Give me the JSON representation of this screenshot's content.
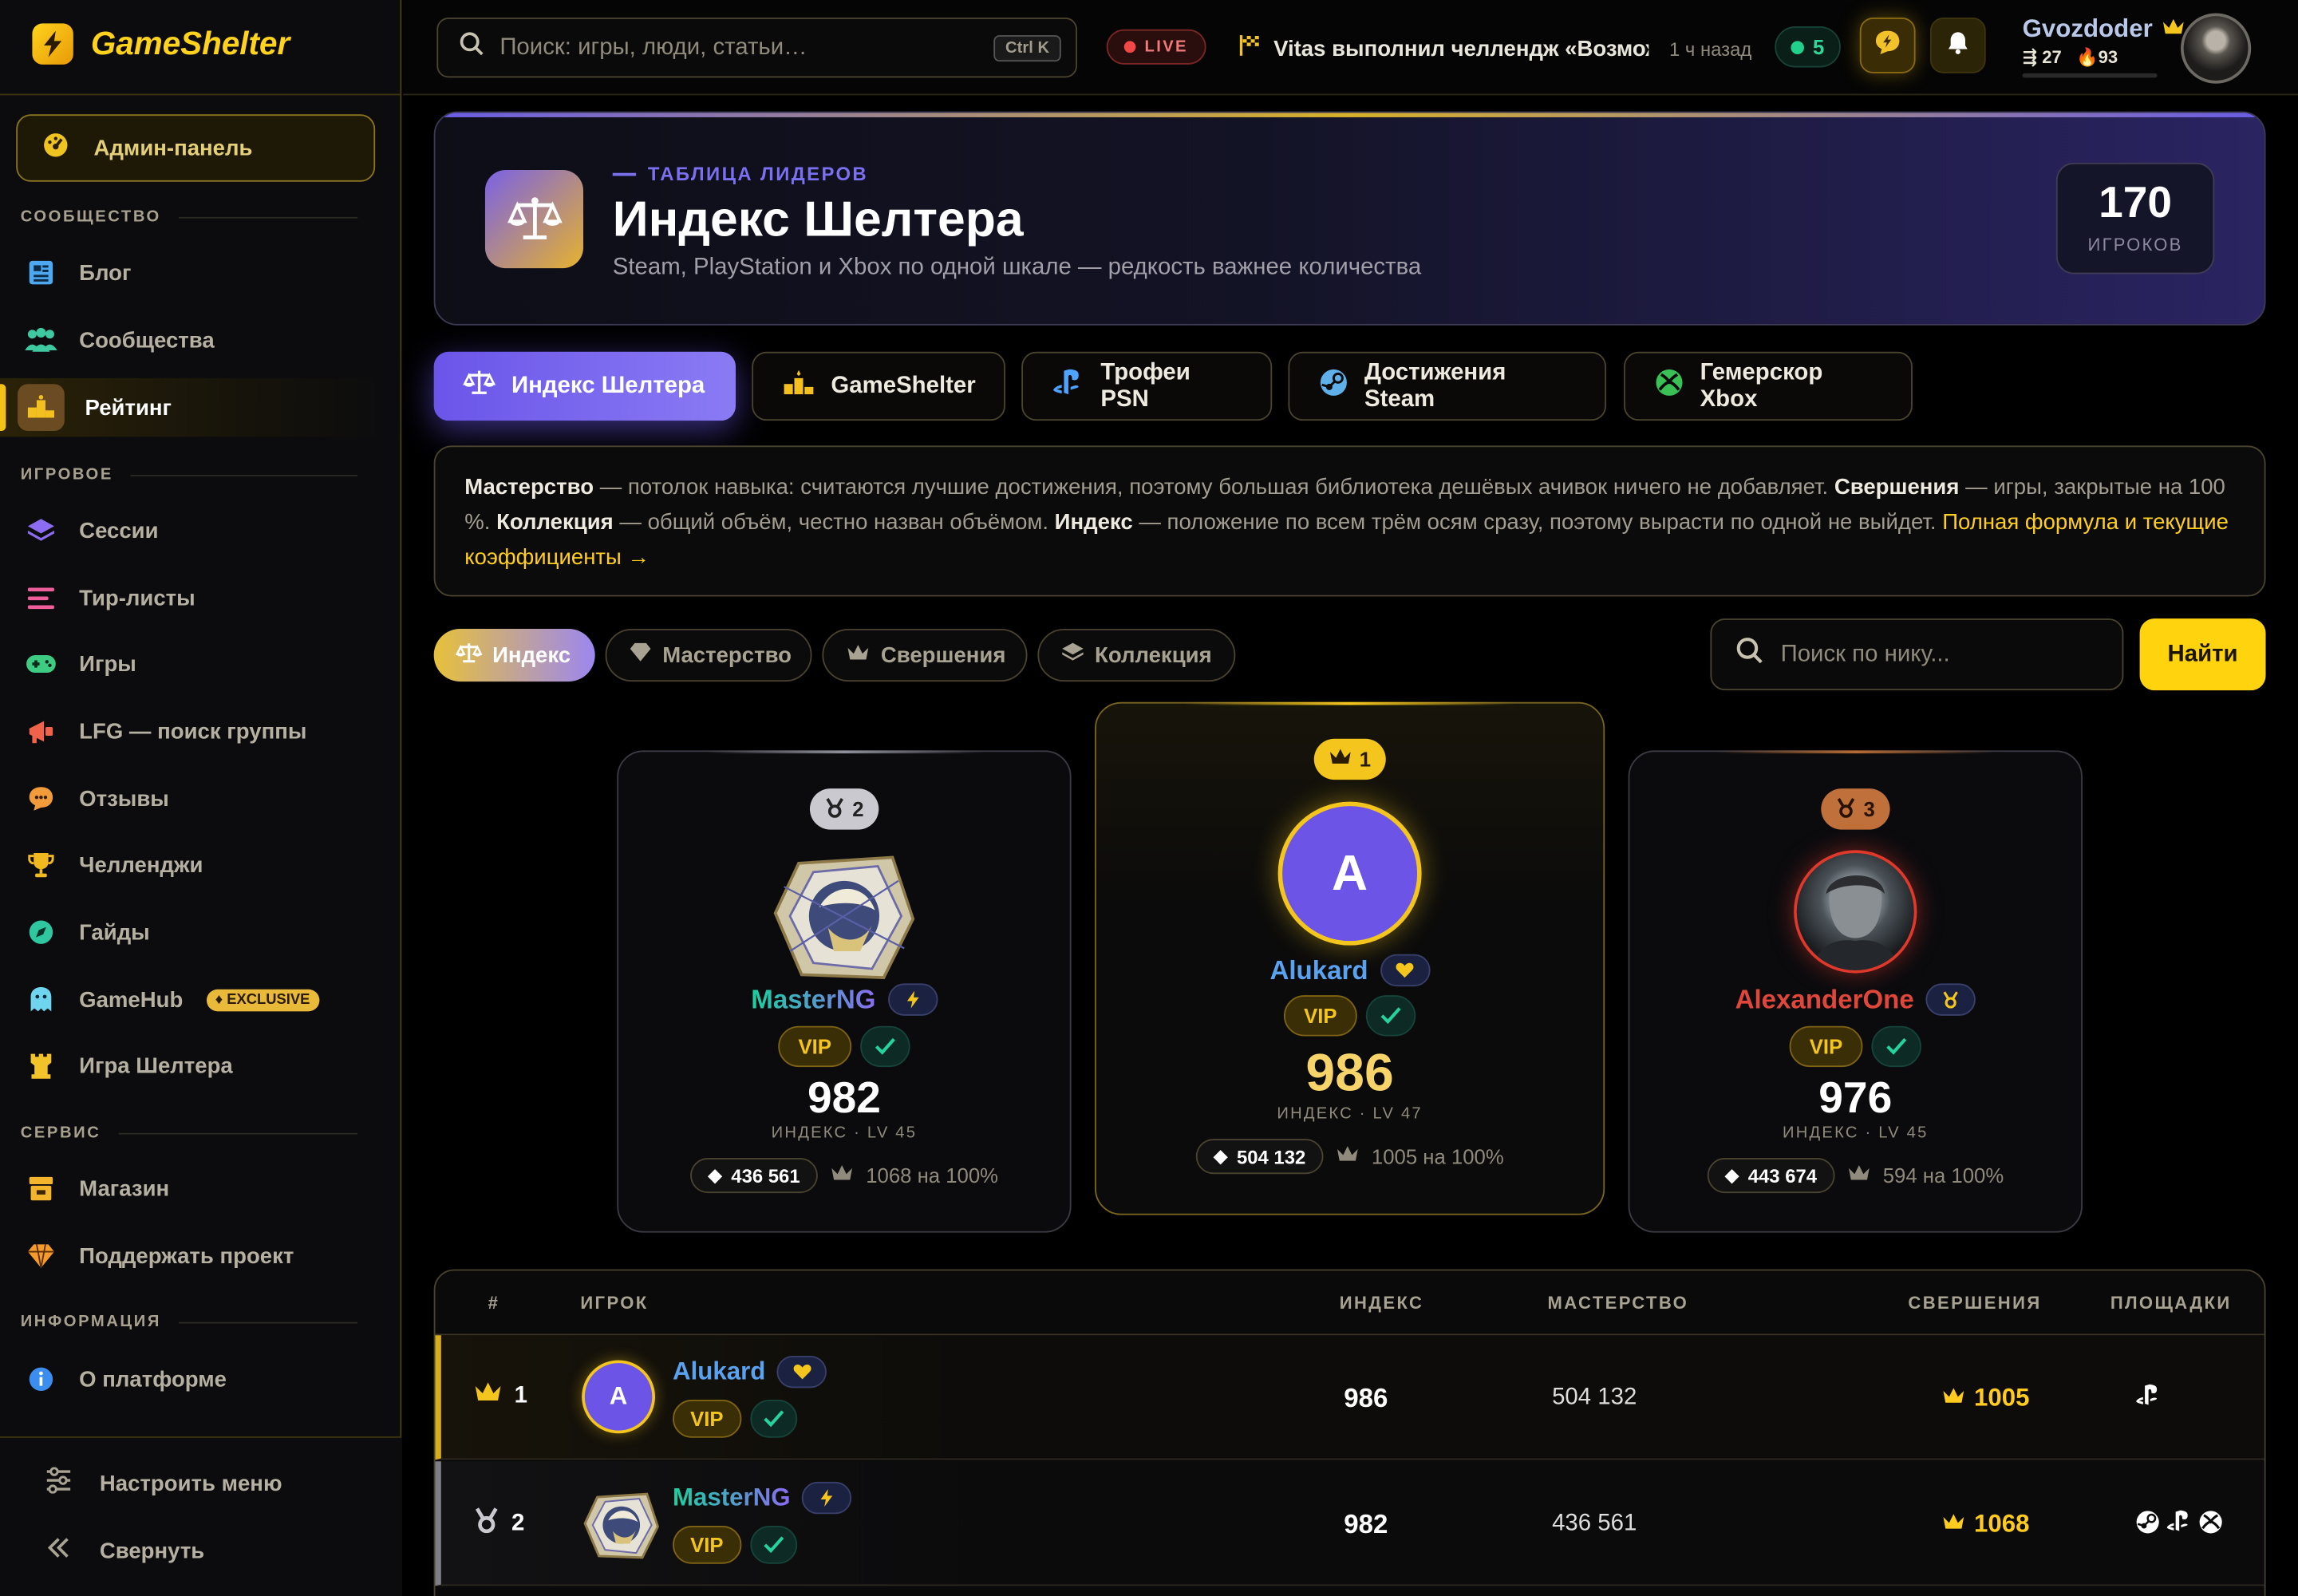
{
  "app": {
    "name": "GameShelter"
  },
  "sidebar": {
    "admin": "Админ-панель",
    "sections": {
      "community": "СООБЩЕСТВО",
      "gaming": "ИГРОВОЕ",
      "service": "СЕРВИС",
      "info": "ИНФОРМАЦИЯ"
    },
    "items": [
      {
        "label": "Блог",
        "icon": "newspaper-icon"
      },
      {
        "label": "Сообщества",
        "icon": "people-icon"
      },
      {
        "label": "Рейтинг",
        "icon": "podium-icon",
        "active": true
      },
      {
        "label": "Сессии",
        "icon": "layers-icon"
      },
      {
        "label": "Тир-листы",
        "icon": "list-icon"
      },
      {
        "label": "Игры",
        "icon": "gamepad-icon"
      },
      {
        "label": "LFG — поиск группы",
        "icon": "megaphone-icon"
      },
      {
        "label": "Отзывы",
        "icon": "chat-icon"
      },
      {
        "label": "Челленджи",
        "icon": "trophy-icon"
      },
      {
        "label": "Гайды",
        "icon": "compass-icon"
      },
      {
        "label": "GameHub",
        "icon": "ghost-icon",
        "badge": "EXCLUSIVE"
      },
      {
        "label": "Игра Шелтера",
        "icon": "tower-icon"
      },
      {
        "label": "Магазин",
        "icon": "shop-icon"
      },
      {
        "label": "Поддержать проект",
        "icon": "diamond-icon"
      },
      {
        "label": "О платформе",
        "icon": "info-icon"
      }
    ],
    "customize": "Настроить меню",
    "collapse": "Свернуть"
  },
  "topbar": {
    "search_placeholder": "Поиск: игры, люди, статьи…",
    "search_shortcut": "Ctrl K",
    "live": "LIVE",
    "ticker_text": "Vitas выполнил челлендж «Возможности»",
    "ticker_time": "1 ч назад",
    "online": "5",
    "user": {
      "name": "Gvozdoder",
      "followers": "27",
      "streak": "93"
    }
  },
  "hero": {
    "kicker": "ТАБЛИЦА ЛИДЕРОВ",
    "title": "Индекс Шелтера",
    "subtitle": "Steam, PlayStation и Xbox по одной шкале — редкость важнее количества",
    "count": "170",
    "count_label": "ИГРОКОВ"
  },
  "tabs": [
    "Индекс Шелтера",
    "GameShelter",
    "Трофеи PSN",
    "Достижения Steam",
    "Гемерскор Xbox"
  ],
  "info": {
    "t1": "Мастерство",
    "t2": " — потолок навыка: считаются лучшие достижения, поэтому большая библиотека дешёвых ачивок ничего не добавляет. ",
    "t3": "Свершения",
    "t4": " — игры, закрытые на 100 %. ",
    "t5": "Коллекция",
    "t6": " — общий объём, честно назван объёмом. ",
    "t7": "Индекс",
    "t8": " — положение по всем трём осям сразу, поэтому вырасти по одной не выйдет. ",
    "link": "Полная формула и текущие коэффициенты →"
  },
  "filters": [
    "Индекс",
    "Мастерство",
    "Свершения",
    "Коллекция"
  ],
  "nick_search": {
    "placeholder": "Поиск по нику...",
    "button": "Найти"
  },
  "podium": [
    {
      "place": "2",
      "name": "MasterNG",
      "vip": "VIP",
      "score": "982",
      "label": "ИНДЕКС · LV 45",
      "mastery": "436 561",
      "completed": "1068 на 100%"
    },
    {
      "place": "1",
      "name": "Alukard",
      "initial": "A",
      "vip": "VIP",
      "score": "986",
      "label": "ИНДЕКС · LV 47",
      "mastery": "504 132",
      "completed": "1005 на 100%"
    },
    {
      "place": "3",
      "name": "AlexanderOne",
      "vip": "VIP",
      "score": "976",
      "label": "ИНДЕКС · LV 45",
      "mastery": "443 674",
      "completed": "594 на 100%"
    }
  ],
  "table": {
    "headers": {
      "rank": "#",
      "player": "ИГРОК",
      "index": "ИНДЕКС",
      "mastery": "МАСТЕРСТВО",
      "completed": "СВЕРШЕНИЯ",
      "platforms": "ПЛОЩАДКИ"
    },
    "rows": [
      {
        "rank": "1",
        "name": "Alukard",
        "initial": "A",
        "vip": "VIP",
        "index": "986",
        "mastery": "504 132",
        "completed": "1005",
        "platforms": [
          "playstation-icon"
        ]
      },
      {
        "rank": "2",
        "name": "MasterNG",
        "vip": "VIP",
        "index": "982",
        "mastery": "436 561",
        "completed": "1068",
        "platforms": [
          "steam-icon",
          "playstation-icon",
          "xbox-icon"
        ]
      }
    ]
  },
  "colors": {
    "accent": "#ffd40f",
    "purple": "#6a55e9",
    "gold": "#f4c61d",
    "green": "#21d18b"
  }
}
